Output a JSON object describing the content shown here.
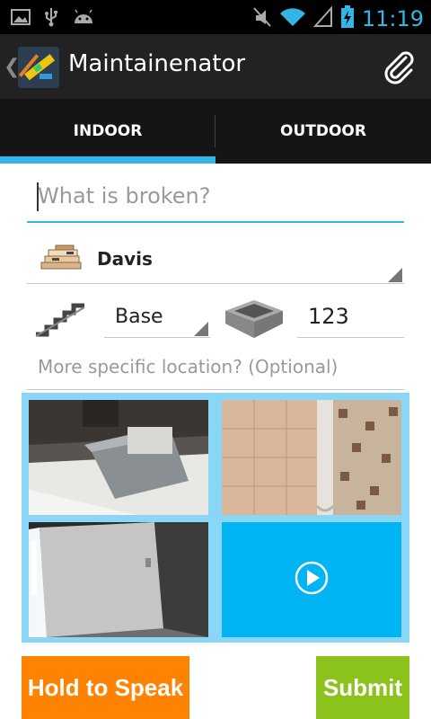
{
  "status_bar": {
    "time": "11:19",
    "left_icons": [
      "picture-icon",
      "usb-icon",
      "android-icon"
    ],
    "right_icons": [
      "mute-icon",
      "wifi-icon",
      "signal-icon",
      "battery-charging-icon"
    ],
    "clock_color": "#33b5e5"
  },
  "action_bar": {
    "title": "Maintainenator",
    "app_icon": "ruler-level-app-icon",
    "attach_icon": "paperclip-icon"
  },
  "tabs": {
    "items": [
      {
        "label": "INDOOR",
        "active": true
      },
      {
        "label": "OUTDOOR",
        "active": false
      }
    ],
    "accent": "#33b5e5"
  },
  "form": {
    "what_placeholder": "What is broken?",
    "building": {
      "value": "Davis",
      "icon": "building-stack-icon"
    },
    "floor": {
      "value": "Base",
      "icon": "stairs-icon"
    },
    "room": {
      "value": "123",
      "icon": "room-box-icon"
    },
    "specific_placeholder": "More specific location? (Optional)"
  },
  "media": {
    "items": [
      {
        "kind": "photo",
        "name": "photo-thumbnail-1"
      },
      {
        "kind": "photo",
        "name": "photo-thumbnail-2"
      },
      {
        "kind": "photo",
        "name": "photo-thumbnail-3"
      },
      {
        "kind": "video",
        "name": "video-thumbnail",
        "icon": "play-icon"
      }
    ],
    "grid_color": "#8ad6f6",
    "video_color": "#01b4f4"
  },
  "buttons": {
    "speak_label": "Hold to Speak",
    "speak_color": "#ff8200",
    "submit_label": "Submit",
    "submit_color": "#8bc31c"
  }
}
